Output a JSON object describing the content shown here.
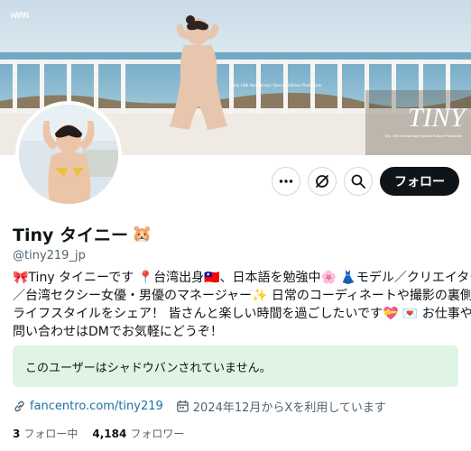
{
  "banner": {
    "watermark": "iWIN",
    "caption": "Tiny 10th Anniversary Special Edition Photobook",
    "logo_text": "TINY",
    "logo_subtitle": "Tiny 10th Anniversary Special Edition Photobook"
  },
  "profile": {
    "display_name": "Tiny タイニー",
    "name_emoji": "🐹",
    "handle": "@tiny219_jp"
  },
  "actions": {
    "more_icon": "more-icon",
    "grok_icon": "grok-icon",
    "search_icon": "search-icon",
    "follow_label": "フォロー"
  },
  "bio": {
    "line1": "🎀Tiny タイニーです 📍台湾出身🇹🇼、日本語を勉強中🌸 👗モデル／クリエイター",
    "line2": "／台湾セクシー女優・男優のマネージャー✨ 日常のコーディネートや撮影の裏側、",
    "line3": "ライフスタイルをシェア！ 皆さんと楽しい時間を過ごしたいです💝 💌 お仕事やお",
    "line4": "問い合わせはDMでお気軽にどうぞ！"
  },
  "notice": {
    "text": "このユーザーはシャドウバンされていません。"
  },
  "meta": {
    "link_icon": "link-icon",
    "link_text": "fancentro.com/tiny219",
    "calendar_icon": "calendar-icon",
    "joined_text": "2024年12月からXを利用しています"
  },
  "stats": {
    "following_count": "3",
    "following_label": "フォロー中",
    "followers_count": "4,184",
    "followers_label": "フォロワー"
  },
  "colors": {
    "accent_link": "#1d6fa5",
    "notice_bg": "#dff4e3",
    "follow_bg": "#0f1419"
  }
}
